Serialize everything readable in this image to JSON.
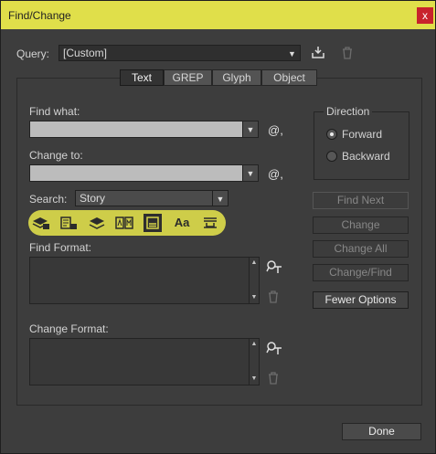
{
  "window": {
    "title": "Find/Change",
    "close_glyph": "x"
  },
  "query": {
    "label": "Query:",
    "value": "[Custom]"
  },
  "tabs": [
    {
      "label": "Text"
    },
    {
      "label": "GREP"
    },
    {
      "label": "Glyph"
    },
    {
      "label": "Object"
    }
  ],
  "find_what": {
    "label": "Find what:",
    "value": "",
    "special_glyph": "@,"
  },
  "change_to": {
    "label": "Change to:",
    "value": "",
    "special_glyph": "@,"
  },
  "search": {
    "label": "Search:",
    "value": "Story"
  },
  "toolbar_icons": [
    "include-locked-layers-icon",
    "include-locked-stories-icon",
    "include-hidden-layers-icon",
    "include-master-pages-icon",
    "include-footnotes-icon",
    "case-sensitive-icon",
    "whole-word-icon"
  ],
  "toolbar_glyphs": {
    "case": "Aa"
  },
  "find_format": {
    "label": "Find Format:"
  },
  "change_format": {
    "label": "Change Format:"
  },
  "direction": {
    "title": "Direction",
    "forward": "Forward",
    "backward": "Backward",
    "selected": "Forward"
  },
  "buttons": {
    "find_next": "Find Next",
    "change": "Change",
    "change_all": "Change All",
    "change_find": "Change/Find",
    "fewer_options": "Fewer Options",
    "done": "Done"
  },
  "colors": {
    "titlebar": "#e0df4a",
    "highlight": "#d6d54a",
    "close": "#c8232c"
  }
}
